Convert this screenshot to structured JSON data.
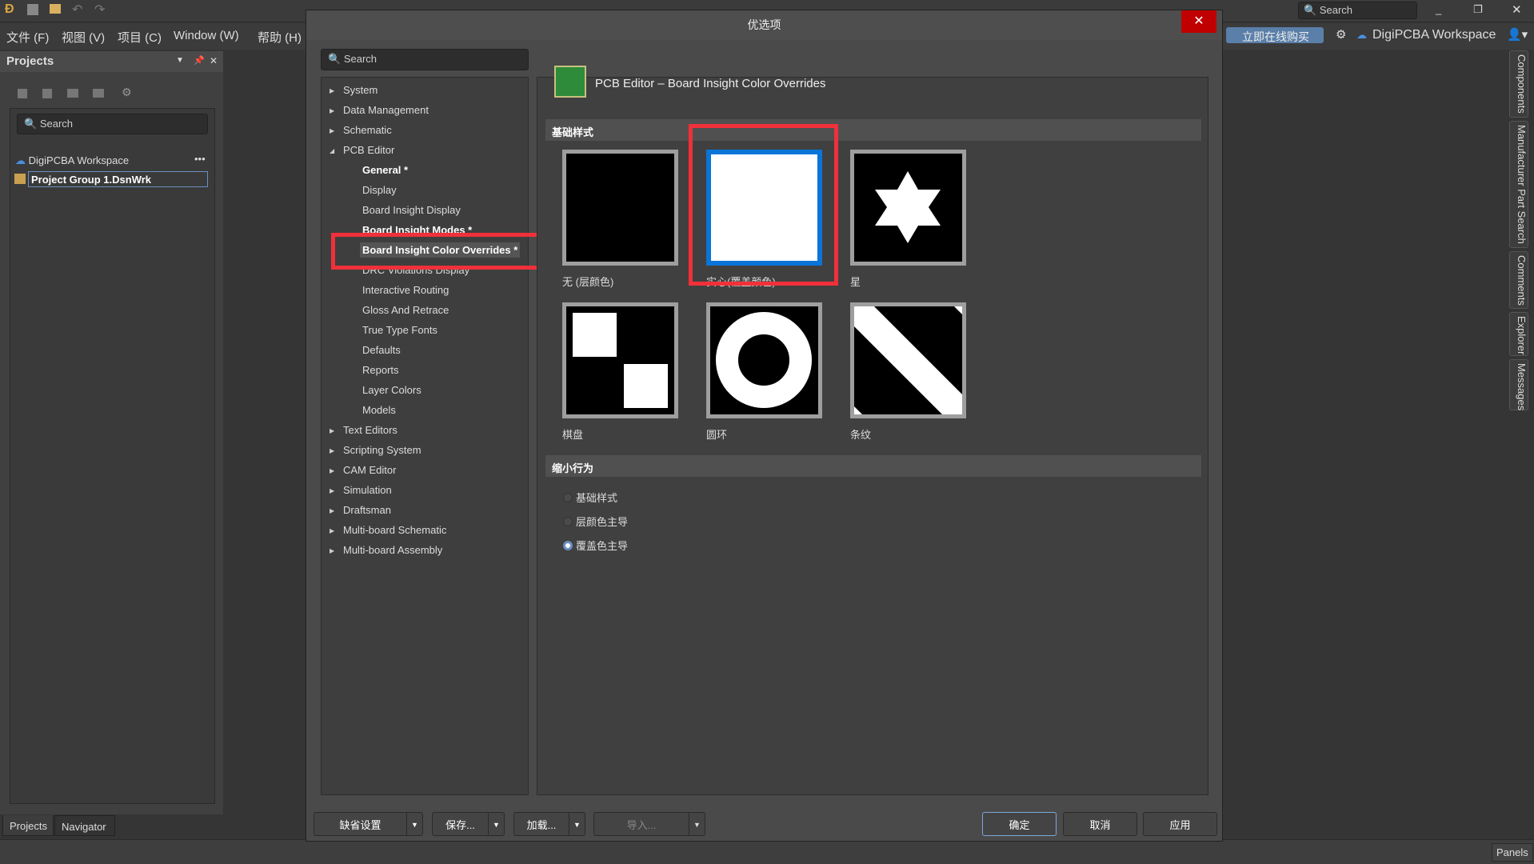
{
  "app": {
    "menu": [
      "文件 (F)",
      "视图 (V)",
      "项目 (C)",
      "Window (W)",
      "帮助 (H)"
    ],
    "search_placeholder": "Search",
    "buy_label": "立即在线购买",
    "workspace_label": "DigiPCBA Workspace"
  },
  "projects_panel": {
    "title": "Projects",
    "search_placeholder": "Search",
    "workspace": "DigiPCBA Workspace",
    "project_group": "Project Group 1.DsnWrk",
    "tabs": [
      "Projects",
      "Navigator"
    ]
  },
  "dialog": {
    "title": "优选项",
    "search_placeholder": "Search",
    "tree": [
      {
        "label": "System",
        "level": 0,
        "arrow": "right"
      },
      {
        "label": "Data Management",
        "level": 0,
        "arrow": "right"
      },
      {
        "label": "Schematic",
        "level": 0,
        "arrow": "right"
      },
      {
        "label": "PCB Editor",
        "level": 0,
        "arrow": "down"
      },
      {
        "label": "General *",
        "level": 1,
        "bold": true
      },
      {
        "label": "Display",
        "level": 1
      },
      {
        "label": "Board Insight Display",
        "level": 1
      },
      {
        "label": "Board Insight Modes *",
        "level": 1,
        "bold": true
      },
      {
        "label": "Board Insight Color Overrides *",
        "level": 1,
        "bold": true,
        "selected": true
      },
      {
        "label": "DRC Violations Display",
        "level": 1
      },
      {
        "label": "Interactive Routing",
        "level": 1
      },
      {
        "label": "Gloss And Retrace",
        "level": 1
      },
      {
        "label": "True Type Fonts",
        "level": 1
      },
      {
        "label": "Defaults",
        "level": 1
      },
      {
        "label": "Reports",
        "level": 1
      },
      {
        "label": "Layer Colors",
        "level": 1
      },
      {
        "label": "Models",
        "level": 1
      },
      {
        "label": "Text Editors",
        "level": 0,
        "arrow": "right"
      },
      {
        "label": "Scripting System",
        "level": 0,
        "arrow": "right"
      },
      {
        "label": "CAM Editor",
        "level": 0,
        "arrow": "right"
      },
      {
        "label": "Simulation",
        "level": 0,
        "arrow": "right"
      },
      {
        "label": "Draftsman",
        "level": 0,
        "arrow": "right"
      },
      {
        "label": "Multi-board Schematic",
        "level": 0,
        "arrow": "right"
      },
      {
        "label": "Multi-board Assembly",
        "level": 0,
        "arrow": "right"
      }
    ],
    "page_title": "PCB Editor – Board Insight Color Overrides",
    "base_pattern_header": "基础样式",
    "patterns": [
      {
        "label": "无 (层颜色)",
        "kind": "none"
      },
      {
        "label": "实心(覆盖颜色)",
        "kind": "solid",
        "selected": true
      },
      {
        "label": "星",
        "kind": "star"
      },
      {
        "label": "棋盘",
        "kind": "checker"
      },
      {
        "label": "圆环",
        "kind": "ring"
      },
      {
        "label": "条纹",
        "kind": "stripe"
      }
    ],
    "zoom_header": "缩小行为",
    "zoom_options": [
      {
        "label": "基础样式",
        "checked": false
      },
      {
        "label": "层颜色主导",
        "checked": false
      },
      {
        "label": "覆盖色主导",
        "checked": true
      }
    ],
    "buttons": {
      "defaults": "缺省设置",
      "save": "保存...",
      "load": "加载...",
      "import": "导入...",
      "ok": "确定",
      "cancel": "取消",
      "apply": "应用"
    }
  },
  "right_tabs": [
    "Components",
    "Manufacturer Part Search",
    "Comments",
    "Explorer",
    "Messages"
  ],
  "status": {
    "panels": "Panels"
  },
  "colors": {
    "highlight": "#f0303a",
    "selected_border": "#0a74d8",
    "close": "#c00000"
  }
}
